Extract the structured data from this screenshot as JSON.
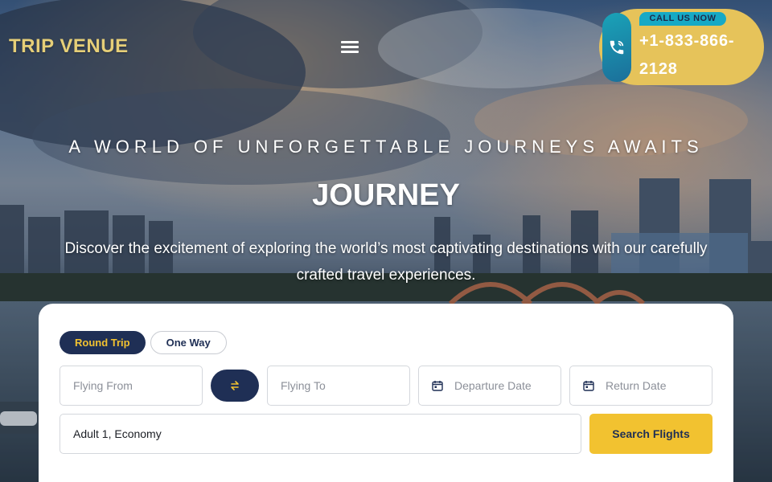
{
  "header": {
    "logo": "TRIP VENUE",
    "call": {
      "tag": "CALL US NOW",
      "number": "+1-833-866-2128"
    }
  },
  "hero": {
    "tagline": "A WORLD OF UNFORGETTABLE JOURNEYS AWAITS",
    "title": "JOURNEY",
    "description": "Discover the excitement of exploring the world’s most captivating destinations with our carefully crafted travel experiences."
  },
  "search": {
    "trip_types": [
      "Round Trip",
      "One Way"
    ],
    "selected_trip_type": "Round Trip",
    "flying_from_placeholder": "Flying From",
    "flying_to_placeholder": "Flying To",
    "departure_placeholder": "Departure Date",
    "return_placeholder": "Return Date",
    "passengers_value": "Adult 1, Economy",
    "search_label": "Search Flights"
  },
  "icons": {
    "menu": "hamburger-menu-icon",
    "phone": "phone-call-icon",
    "swap": "swap-arrows-icon",
    "calendar": "calendar-icon"
  },
  "colors": {
    "logo": "#e6cf78",
    "navy": "#1f2f55",
    "accent_yellow": "#f2c230",
    "call_box": "#e6c35a",
    "call_tag": "#17a9c5"
  }
}
